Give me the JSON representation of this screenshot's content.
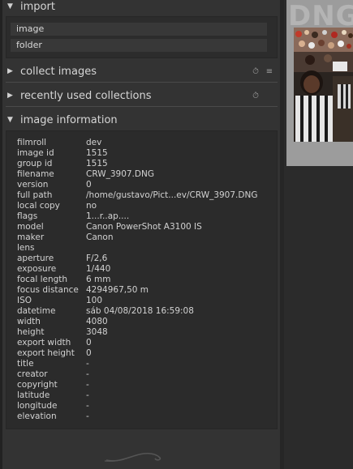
{
  "modules": {
    "import": {
      "title": "import",
      "buttons": [
        "image",
        "folder"
      ]
    },
    "collect": {
      "title": "collect images",
      "icons": [
        "reset-icon",
        "presets-icon"
      ]
    },
    "recent": {
      "title": "recently used collections",
      "icons": [
        "reset-icon"
      ]
    },
    "info": {
      "title": "image information"
    }
  },
  "image_info": [
    {
      "key": "filmroll",
      "value": "dev"
    },
    {
      "key": "image id",
      "value": "1515"
    },
    {
      "key": "group id",
      "value": "1515"
    },
    {
      "key": "filename",
      "value": "CRW_3907.DNG"
    },
    {
      "key": "version",
      "value": "0"
    },
    {
      "key": "full path",
      "value": " /home/gustavo/Pict...ev/CRW_3907.DNG"
    },
    {
      "key": "local copy",
      "value": "no"
    },
    {
      "key": "flags",
      "value": "1...r..ap...."
    },
    {
      "key": "model",
      "value": "Canon PowerShot A3100 IS"
    },
    {
      "key": "maker",
      "value": "Canon"
    },
    {
      "key": "lens",
      "value": ""
    },
    {
      "key": "aperture",
      "value": "F/2,6"
    },
    {
      "key": "exposure",
      "value": "1/440"
    },
    {
      "key": "focal length",
      "value": "6 mm"
    },
    {
      "key": "focus distance",
      "value": "4294967,50 m"
    },
    {
      "key": "ISO",
      "value": "100"
    },
    {
      "key": "datetime",
      "value": "sáb 04/08/2018 16:59:08"
    },
    {
      "key": "width",
      "value": "4080"
    },
    {
      "key": "height",
      "value": "3048"
    },
    {
      "key": "export width",
      "value": "0"
    },
    {
      "key": "export height",
      "value": "0"
    },
    {
      "key": "title",
      "value": "-"
    },
    {
      "key": "creator",
      "value": "-"
    },
    {
      "key": "copyright",
      "value": "-"
    },
    {
      "key": "latitude",
      "value": "-"
    },
    {
      "key": "longitude",
      "value": "-"
    },
    {
      "key": "elevation",
      "value": "-"
    }
  ],
  "thumbnail": {
    "badge": "DNG"
  },
  "colors": {
    "panel_bg": "#333333",
    "box_bg": "#2b2b2b",
    "text": "#d2d2d2"
  }
}
